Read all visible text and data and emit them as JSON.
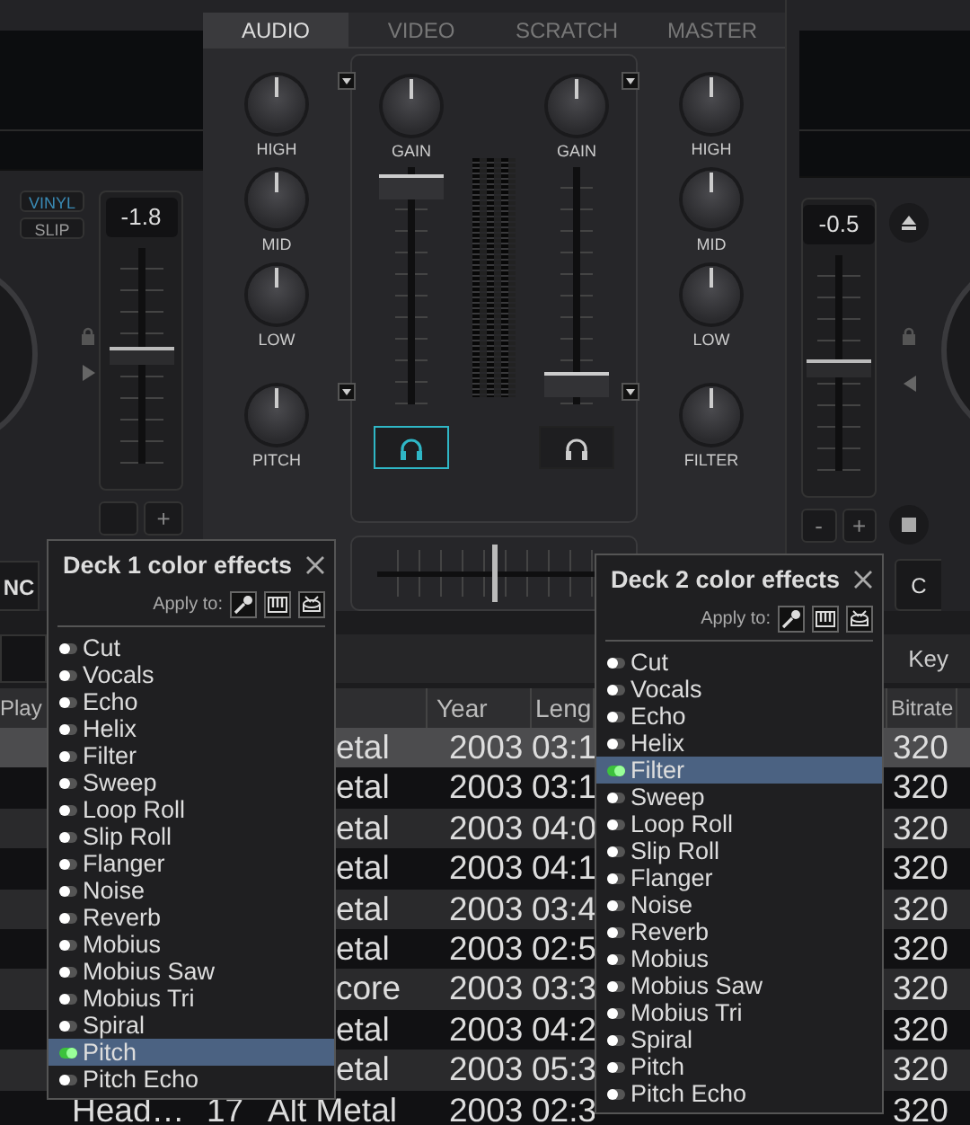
{
  "mixer_tabs": [
    {
      "label": "AUDIO",
      "selected": true
    },
    {
      "label": "VIDEO",
      "selected": false
    },
    {
      "label": "SCRATCH",
      "selected": false
    },
    {
      "label": "MASTER",
      "selected": false
    }
  ],
  "deck_left": {
    "modes": [
      {
        "label": "VINYL",
        "on": true
      },
      {
        "label": "SLIP",
        "on": false
      }
    ],
    "pitch_value": "-1.8",
    "pitch": {
      "level": 0.5
    },
    "plus": "+",
    "sync": "NC"
  },
  "deck_right": {
    "pitch_value": "-0.5",
    "pitch": {
      "level": 0.47
    },
    "minus": "-",
    "plus": "+",
    "button": "C"
  },
  "mixer": {
    "left_eq": [
      "HIGH",
      "MID",
      "LOW",
      "PITCH"
    ],
    "right_eq": [
      "HIGH",
      "MID",
      "LOW",
      "FILTER"
    ],
    "channels": [
      {
        "gain_label": "GAIN",
        "fader": {
          "level": 0.97
        },
        "pfl": true
      },
      {
        "gain_label": "GAIN",
        "fader": {
          "level": 0.03
        },
        "pfl": false
      }
    ],
    "crossfader": {
      "level": 0.5
    }
  },
  "browser": {
    "toolbar_label": "Key",
    "columns": [
      "Play",
      "Year",
      "Leng",
      "Bitrate"
    ],
    "rows": [
      {
        "genre": "etal",
        "year": "2003",
        "length": "03:1",
        "bitrate": "320",
        "selected": true
      },
      {
        "genre": "etal",
        "year": "2003",
        "length": "03:1",
        "bitrate": "320",
        "selected": false
      },
      {
        "genre": "etal",
        "year": "2003",
        "length": "04:0",
        "bitrate": "320",
        "selected": false
      },
      {
        "genre": "etal",
        "year": "2003",
        "length": "04:1",
        "bitrate": "320",
        "selected": false
      },
      {
        "genre": "etal",
        "year": "2003",
        "length": "03:4",
        "bitrate": "320",
        "selected": false
      },
      {
        "genre": "etal",
        "year": "2003",
        "length": "02:5",
        "bitrate": "320",
        "selected": false
      },
      {
        "genre": "core",
        "year": "2003",
        "length": "03:3",
        "bitrate": "320",
        "selected": false
      },
      {
        "genre": "etal",
        "year": "2003",
        "length": "04:2",
        "bitrate": "320",
        "selected": false
      },
      {
        "genre": "etal",
        "year": "2003",
        "length": "05:3",
        "bitrate": "320",
        "selected": false
      },
      {
        "title": "Head…",
        "number": "17",
        "genre": "Alt Metal",
        "year": "2003",
        "length": "02:3",
        "bitrate": "320",
        "selected": false
      }
    ]
  },
  "effect_panels": [
    {
      "title": "Deck 1 color effects",
      "apply_label": "Apply to:",
      "effects": [
        {
          "name": "Cut",
          "selected": false
        },
        {
          "name": "Vocals",
          "selected": false
        },
        {
          "name": "Echo",
          "selected": false
        },
        {
          "name": "Helix",
          "selected": false
        },
        {
          "name": "Filter",
          "selected": false
        },
        {
          "name": "Sweep",
          "selected": false
        },
        {
          "name": "Loop Roll",
          "selected": false
        },
        {
          "name": "Slip Roll",
          "selected": false
        },
        {
          "name": "Flanger",
          "selected": false
        },
        {
          "name": "Noise",
          "selected": false
        },
        {
          "name": "Reverb",
          "selected": false
        },
        {
          "name": "Mobius",
          "selected": false
        },
        {
          "name": "Mobius Saw",
          "selected": false
        },
        {
          "name": "Mobius Tri",
          "selected": false
        },
        {
          "name": "Spiral",
          "selected": false
        },
        {
          "name": "Pitch",
          "selected": true
        },
        {
          "name": "Pitch Echo",
          "selected": false
        }
      ]
    },
    {
      "title": "Deck 2 color effects",
      "apply_label": "Apply to:",
      "effects": [
        {
          "name": "Cut",
          "selected": false
        },
        {
          "name": "Vocals",
          "selected": false
        },
        {
          "name": "Echo",
          "selected": false
        },
        {
          "name": "Helix",
          "selected": false
        },
        {
          "name": "Filter",
          "selected": true
        },
        {
          "name": "Sweep",
          "selected": false
        },
        {
          "name": "Loop Roll",
          "selected": false
        },
        {
          "name": "Slip Roll",
          "selected": false
        },
        {
          "name": "Flanger",
          "selected": false
        },
        {
          "name": "Noise",
          "selected": false
        },
        {
          "name": "Reverb",
          "selected": false
        },
        {
          "name": "Mobius",
          "selected": false
        },
        {
          "name": "Mobius Saw",
          "selected": false
        },
        {
          "name": "Mobius Tri",
          "selected": false
        },
        {
          "name": "Spiral",
          "selected": false
        },
        {
          "name": "Pitch",
          "selected": false
        },
        {
          "name": "Pitch Echo",
          "selected": false
        }
      ]
    }
  ]
}
